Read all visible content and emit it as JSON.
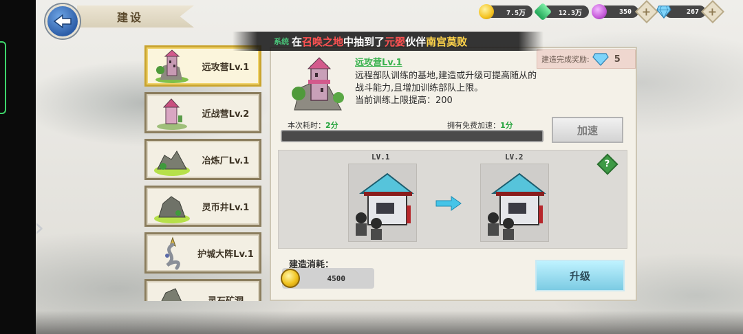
{
  "header": {
    "title": "建设",
    "back_icon": "back-arrow-icon"
  },
  "resources": [
    {
      "name": "gold",
      "value": "7.5万",
      "icon": "gold-coin-icon",
      "color": "#f4c21f"
    },
    {
      "name": "jade",
      "value": "12.3万",
      "icon": "green-gem-icon",
      "color": "#2fc36b"
    },
    {
      "name": "spirit",
      "value": "350",
      "icon": "purple-swirl-icon",
      "color": "#c65ad9"
    },
    {
      "name": "diamond",
      "value": "267",
      "icon": "diamond-icon",
      "color": "#6fc7f4"
    }
  ],
  "broadcast": {
    "tag": "系统",
    "p1": "在",
    "place": "召唤之地",
    "p2": "中抽到了",
    "rarity": "元婴",
    "p3": "伙伴",
    "partner": "南宫莫败"
  },
  "buildings": [
    {
      "label": "远攻营Lv.1",
      "icon": "tower-building-icon",
      "active": true
    },
    {
      "label": "近战营Lv.2",
      "icon": "camp-building-icon",
      "active": false
    },
    {
      "label": "冶炼厂Lv.1",
      "icon": "smelter-rock-icon",
      "active": false
    },
    {
      "label": "灵币井Lv.1",
      "icon": "coin-well-rock-icon",
      "active": false
    },
    {
      "label": "护城大阵Lv.1",
      "icon": "guardian-array-icon",
      "active": false
    },
    {
      "label": "灵石矿洞",
      "icon": "mine-icon",
      "active": false
    }
  ],
  "detail": {
    "title": "远攻营Lv.1",
    "description": "远程部队训练的基地,建造或升级可提高随从的战斗能力,且增加训练部队上限。",
    "limit_line": "当前训练上限提高：200",
    "reward_label": "建造完成奖励:",
    "reward_value": "5",
    "time_label": "本次耗时：",
    "time_value": "2分",
    "free_label": "拥有免费加速：",
    "free_value": "1分",
    "progress": 0,
    "speed_button": "加速",
    "current_level": "LV.1",
    "next_level": "LV.2",
    "help_label": "?",
    "cost_label": "建造消耗：",
    "cost_value": "4500",
    "upgrade_button": "升级"
  }
}
